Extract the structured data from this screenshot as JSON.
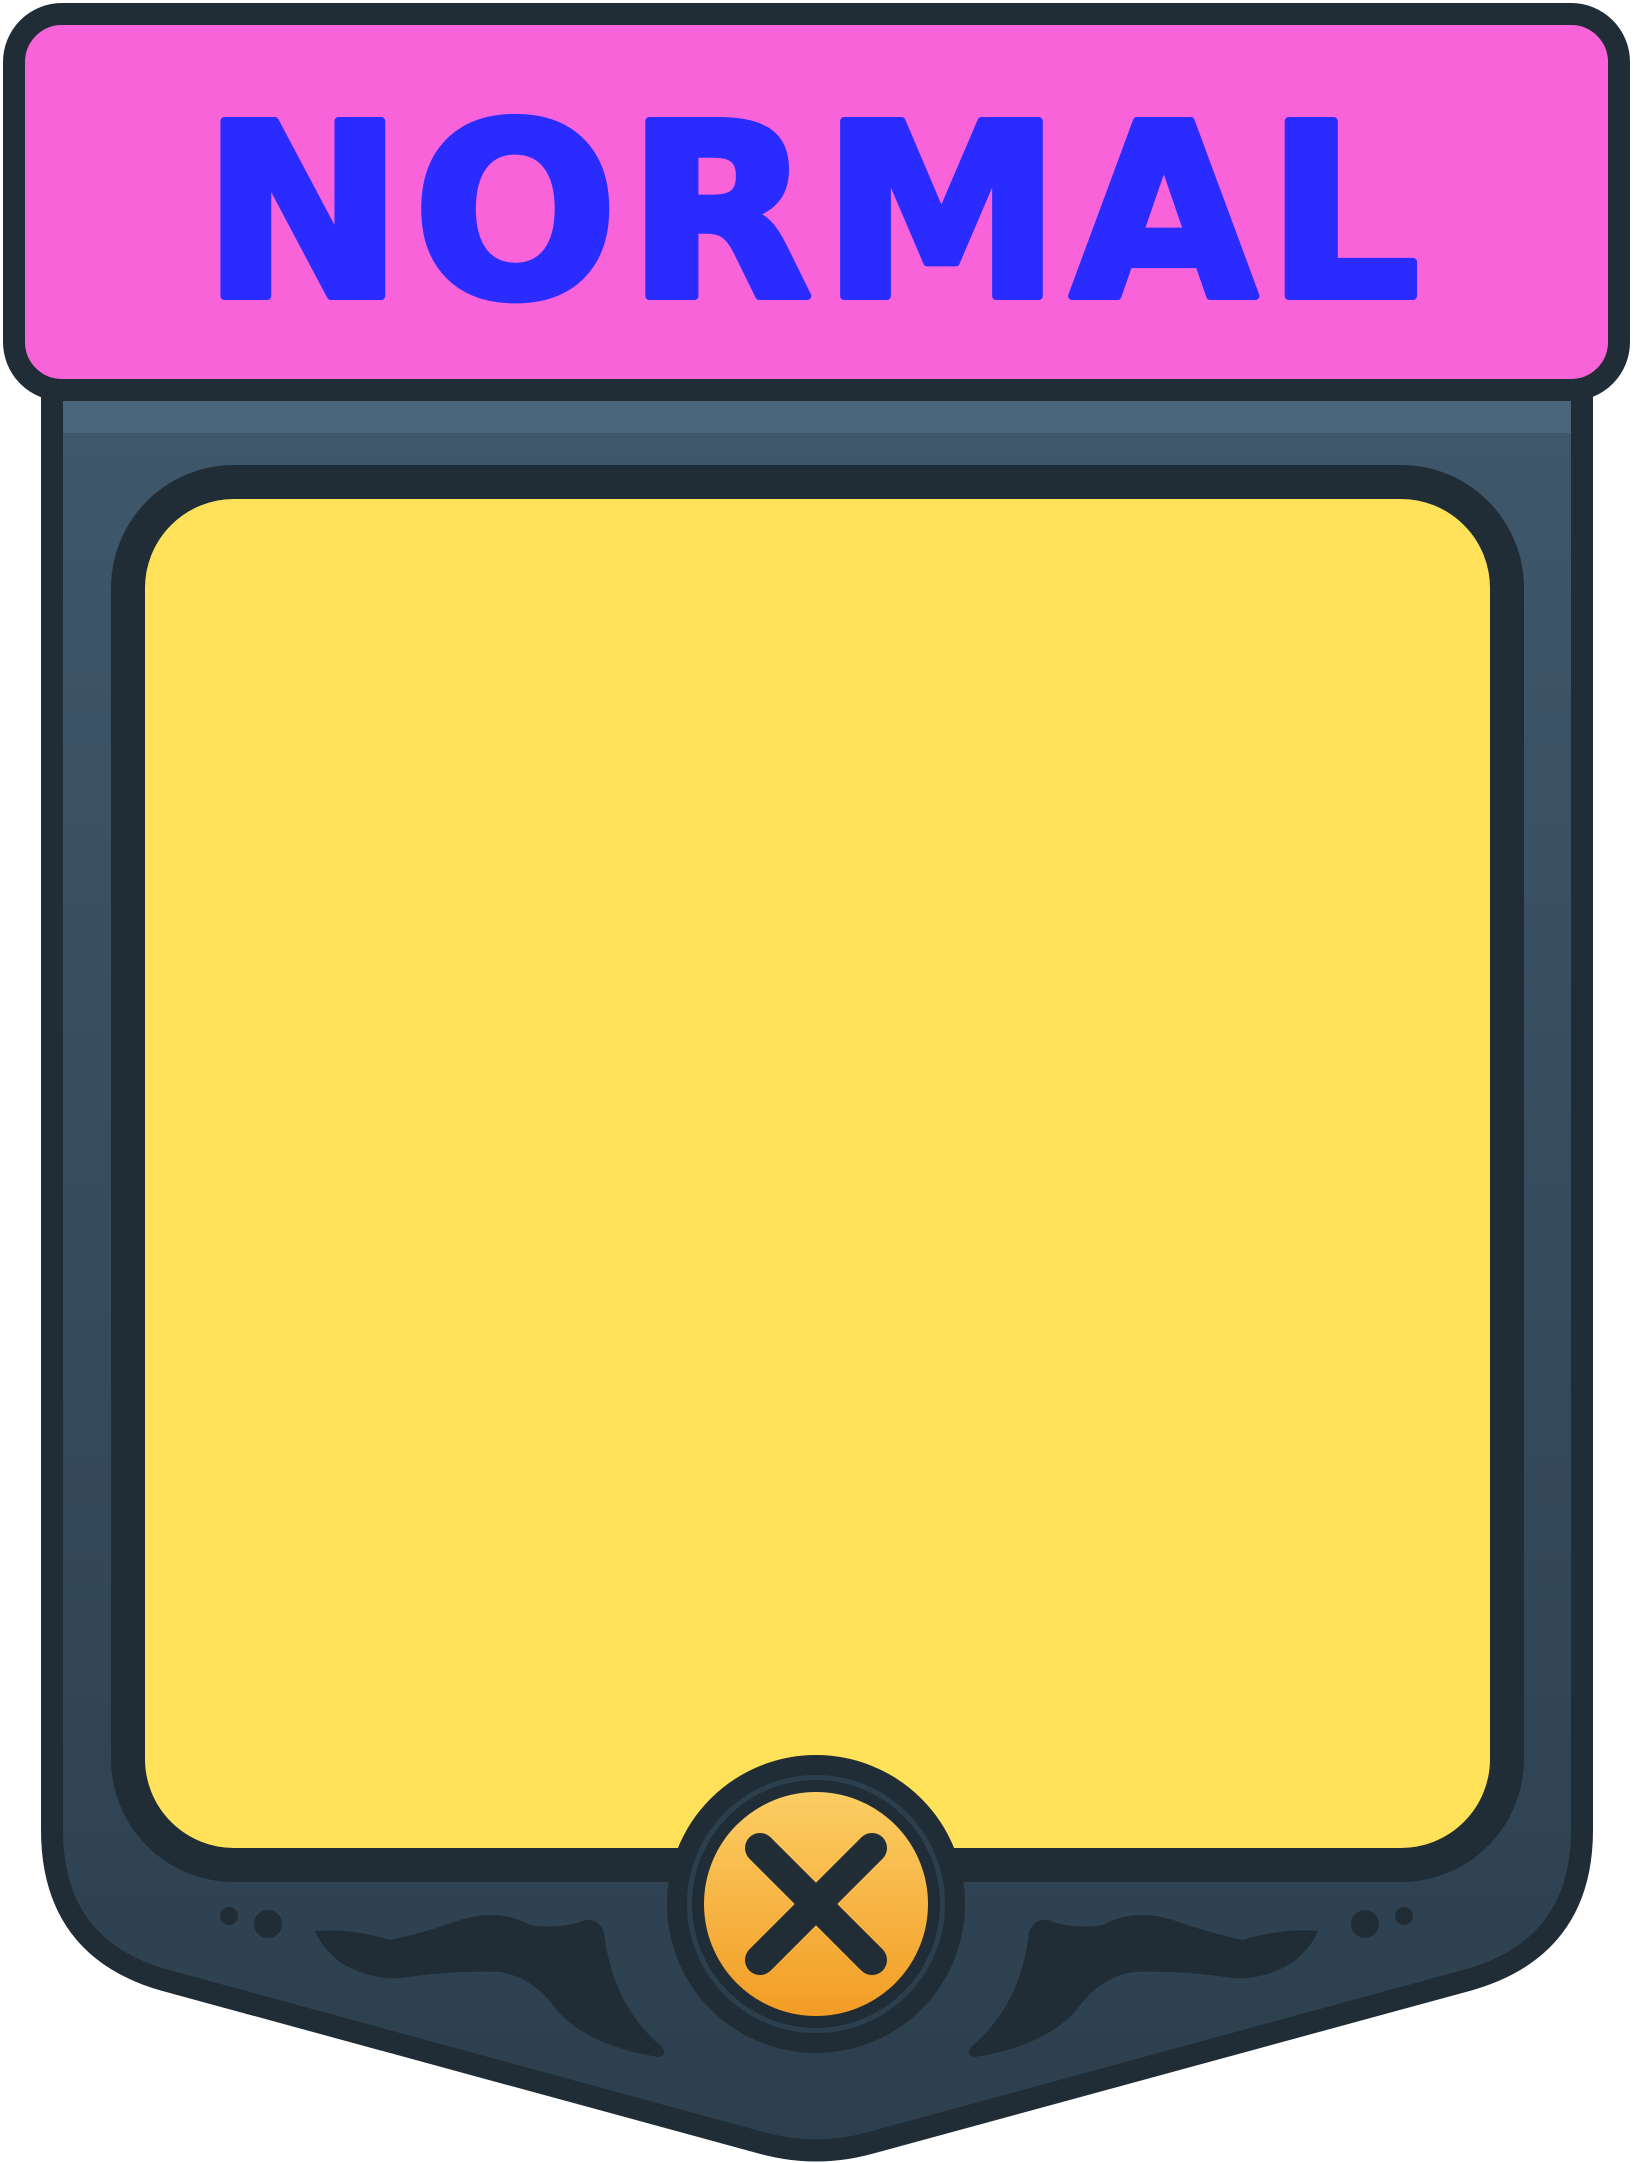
{
  "title": {
    "text": "NORMAL"
  },
  "close_button": {
    "icon": "close-icon",
    "glyph": "x"
  },
  "colors": {
    "outline": "#202d36",
    "title_bar": "#f963d9",
    "title_text": "#2a2cff",
    "frame_top": "#3f586c",
    "frame_bottom": "#2d3f4d",
    "content": "#ffe25a",
    "close_top": "#fccf65",
    "close_bottom": "#f29b23"
  }
}
